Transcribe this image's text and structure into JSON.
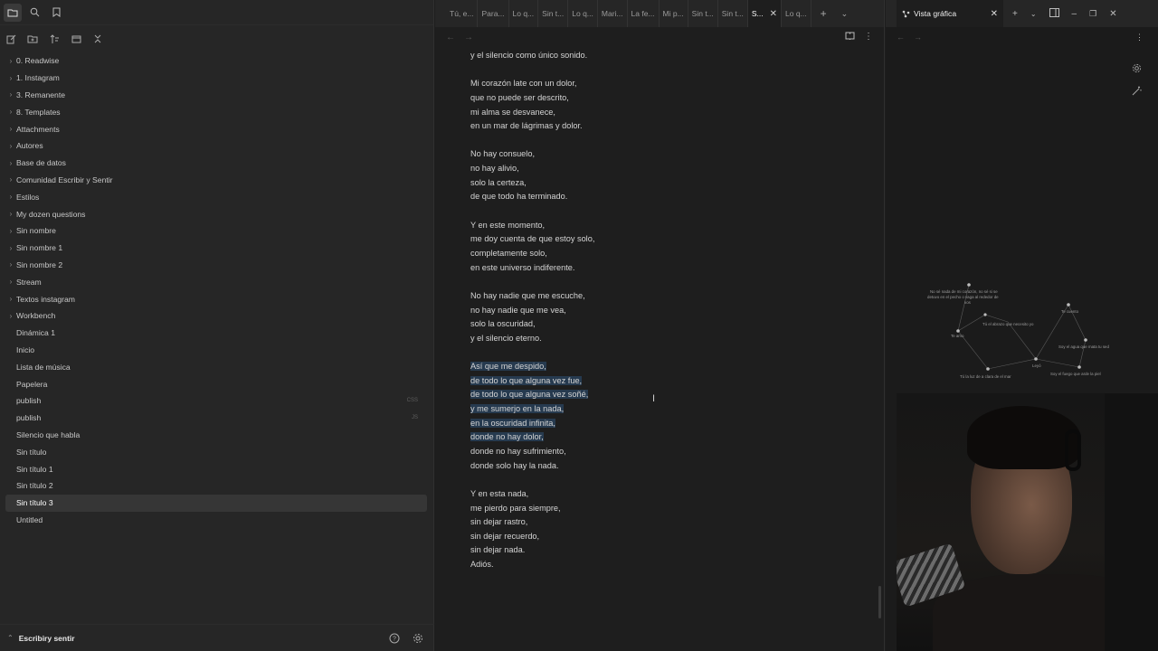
{
  "sidebar": {
    "folders": [
      "0. Readwise",
      "1. Instagram",
      "3. Remanente",
      "8. Templates",
      "Attachments",
      "Autores",
      "Base de datos",
      "Comunidad Escribir y Sentir",
      "Estilos",
      "My dozen questions",
      "Sin nombre",
      "Sin nombre 1",
      "Sin nombre 2",
      "Stream",
      "Textos instagram",
      "Workbench"
    ],
    "files": [
      {
        "label": "Dinámica 1",
        "ext": ""
      },
      {
        "label": "Inicio",
        "ext": ""
      },
      {
        "label": "Lista de música",
        "ext": ""
      },
      {
        "label": "Papelera",
        "ext": ""
      },
      {
        "label": "publish",
        "ext": "CSS"
      },
      {
        "label": "publish",
        "ext": "JS"
      },
      {
        "label": "Silencio que habla",
        "ext": ""
      },
      {
        "label": "Sin título",
        "ext": ""
      },
      {
        "label": "Sin título 1",
        "ext": ""
      },
      {
        "label": "Sin título 2",
        "ext": ""
      },
      {
        "label": "Sin título 3",
        "ext": "",
        "active": true
      },
      {
        "label": "Untitled",
        "ext": ""
      }
    ],
    "vault_name": "Escribiry sentir"
  },
  "tabs": [
    {
      "label": "Tú, e..."
    },
    {
      "label": "Para..."
    },
    {
      "label": "Lo q..."
    },
    {
      "label": "Sin t..."
    },
    {
      "label": "Lo q..."
    },
    {
      "label": "Mari..."
    },
    {
      "label": "La fe..."
    },
    {
      "label": "Mi p..."
    },
    {
      "label": "Sin t..."
    },
    {
      "label": "Sin t..."
    },
    {
      "label": "S...",
      "active": true
    },
    {
      "label": "Lo q..."
    }
  ],
  "poem": {
    "lines": [
      {
        "text": "y el silencio como único sonido.",
        "sel": false
      },
      {
        "text": "",
        "sel": false
      },
      {
        "text": "Mi corazón late con un dolor,",
        "sel": false
      },
      {
        "text": "que no puede ser descrito,",
        "sel": false
      },
      {
        "text": "mi alma se desvanece,",
        "sel": false
      },
      {
        "text": "en un mar de lágrimas y dolor.",
        "sel": false
      },
      {
        "text": "",
        "sel": false
      },
      {
        "text": "No hay consuelo,",
        "sel": false
      },
      {
        "text": "no hay alivio,",
        "sel": false
      },
      {
        "text": "solo la certeza,",
        "sel": false
      },
      {
        "text": "de que todo ha terminado.",
        "sel": false
      },
      {
        "text": "",
        "sel": false
      },
      {
        "text": "Y en este momento,",
        "sel": false
      },
      {
        "text": "me doy cuenta de que estoy solo,",
        "sel": false
      },
      {
        "text": "completamente solo,",
        "sel": false
      },
      {
        "text": "en este universo indiferente.",
        "sel": false
      },
      {
        "text": "",
        "sel": false
      },
      {
        "text": "No hay nadie que me escuche,",
        "sel": false
      },
      {
        "text": "no hay nadie que me vea,",
        "sel": false
      },
      {
        "text": "solo la oscuridad,",
        "sel": false
      },
      {
        "text": "y el silencio eterno.",
        "sel": false
      },
      {
        "text": "",
        "sel": false
      },
      {
        "text": "Así que me despido,",
        "sel": true
      },
      {
        "text": "de todo lo que alguna vez fue,",
        "sel": true
      },
      {
        "text": "de todo lo que alguna vez soñé,",
        "sel": true
      },
      {
        "text": "y me sumerjo en la nada,",
        "sel": true
      },
      {
        "text": "en la oscuridad infinita,",
        "sel": true
      },
      {
        "text": "donde no hay dolor,",
        "sel": true
      },
      {
        "text": "donde no hay sufrimiento,",
        "sel": false
      },
      {
        "text": "donde solo hay la nada.",
        "sel": false
      },
      {
        "text": "",
        "sel": false
      },
      {
        "text": "Y en esta nada,",
        "sel": false
      },
      {
        "text": "me pierdo para siempre,",
        "sel": false
      },
      {
        "text": "sin dejar rastro,",
        "sel": false
      },
      {
        "text": "sin dejar recuerdo,",
        "sel": false
      },
      {
        "text": "sin dejar nada.",
        "sel": false
      },
      {
        "text": "Adiós.",
        "sel": false
      }
    ]
  },
  "graph": {
    "tab_label": "Vista gráfica",
    "nodes": [
      {
        "label": "No sé nada de mi corazón, no sé si se"
      },
      {
        "label": "detuvo en el pecho o vaga al rededor de"
      },
      {
        "label": "vos"
      },
      {
        "label": "Tú el abrazo que necesito yo"
      },
      {
        "label": "Te cuento"
      },
      {
        "label": "Te amo"
      },
      {
        "label": "Soy el agua que mata tu sed"
      },
      {
        "label": "Leyó"
      },
      {
        "label": "Tú la luz de a clara de el mar"
      },
      {
        "label": "Soy el fuego que arde la piel"
      }
    ]
  }
}
